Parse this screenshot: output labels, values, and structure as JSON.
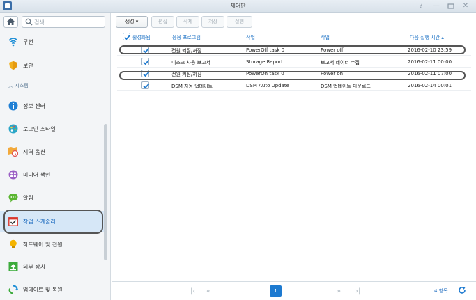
{
  "window": {
    "title": "제어판"
  },
  "search": {
    "placeholder": "검색"
  },
  "sidebar": {
    "section_label": "시스템",
    "items": [
      {
        "label": "무선",
        "icon": "wifi-icon"
      },
      {
        "label": "보안",
        "icon": "shield-icon"
      },
      {
        "label": "정보 센터",
        "icon": "info-icon"
      },
      {
        "label": "로그인 스타일",
        "icon": "palette-icon"
      },
      {
        "label": "지역 옵션",
        "icon": "map-clock-icon"
      },
      {
        "label": "미디어 색인",
        "icon": "media-index-icon"
      },
      {
        "label": "알림",
        "icon": "chat-bubble-icon"
      },
      {
        "label": "작업 스케줄러",
        "icon": "calendar-check-icon",
        "active": true
      },
      {
        "label": "하드웨어 및 전원",
        "icon": "lightbulb-icon"
      },
      {
        "label": "외부 장치",
        "icon": "external-device-icon"
      },
      {
        "label": "업데이트 및 복원",
        "icon": "refresh-icon"
      }
    ]
  },
  "toolbar": {
    "create_label": "생성",
    "edit_label": "편집",
    "delete_label": "삭제",
    "save_label": "저장",
    "run_label": "실행"
  },
  "table": {
    "headers": {
      "enabled": "활성화됨",
      "application": "응용 프로그램",
      "task": "작업",
      "action": "작업",
      "next_run": "다음 실행 시간 ▴"
    },
    "rows": [
      {
        "enabled": true,
        "application": "전원 켜짐/꺼짐",
        "task": "PowerOff task 0",
        "action": "Power off",
        "next_run": "2016-02-10 23:59"
      },
      {
        "enabled": true,
        "application": "디스크 사용 보고서",
        "task": "Storage Report",
        "action": "보고서 데이터 수집",
        "next_run": "2016-02-11 00:00"
      },
      {
        "enabled": true,
        "application": "전원 켜짐/꺼짐",
        "task": "PowerOn task 0",
        "action": "Power on",
        "next_run": "2016-02-11 07:00"
      },
      {
        "enabled": true,
        "application": "DSM 자동 업데이트",
        "task": "DSM Auto Update",
        "action": "DSM 업데이트 다운로드",
        "next_run": "2016-02-14 00:01"
      }
    ]
  },
  "pager": {
    "current_page": "1",
    "item_count": "4 항목"
  },
  "colors": {
    "accent": "#1d7ad0",
    "active_bg": "#d6e7f7"
  }
}
